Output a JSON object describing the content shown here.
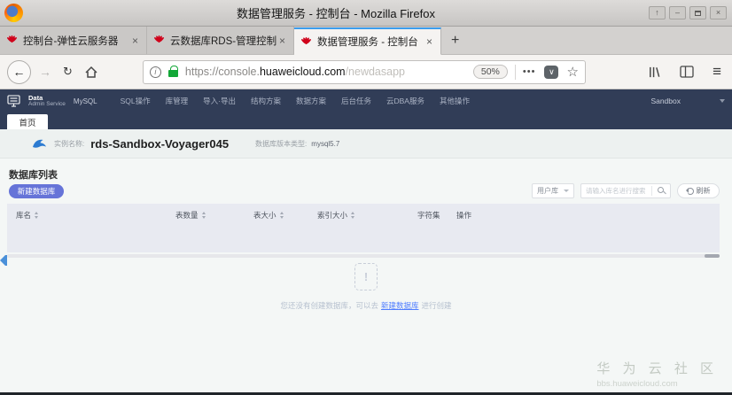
{
  "window": {
    "title": "数据管理服务 - 控制台 - Mozilla Firefox",
    "controls": {
      "shade": "↑",
      "minimize": "–",
      "close": "×"
    }
  },
  "browser": {
    "tabs": [
      {
        "label": "控制台-弹性云服务器",
        "close": "×"
      },
      {
        "label": "云数据库RDS-管理控制台",
        "close": "×"
      },
      {
        "label": "数据管理服务 - 控制台",
        "close": "×"
      }
    ],
    "new_tab": "+",
    "toolbar": {
      "back": "←",
      "forward": "→",
      "reload": "↻",
      "page_actions": "•••",
      "pocket": "∨",
      "bookmark_star": "☆",
      "menu": "≡"
    },
    "url": {
      "scheme_subdomain": "https://console.",
      "domain": "huaweicloud.com",
      "path": "/newdasapp",
      "zoom": "50%"
    }
  },
  "app": {
    "brand": {
      "line1": "Data",
      "line2": "Admin Service",
      "engine": "MySQL",
      "account": "Sandbox"
    },
    "nav": [
      "SQL操作",
      "库管理",
      "导入·导出",
      "结构方案",
      "数据方案",
      "后台任务",
      "云DBA服务",
      "其他操作"
    ],
    "page_tab": "首页",
    "instance": {
      "name_label": "实例名称:",
      "name": "rds-Sandbox-Voyager045",
      "version_label": "数据库版本类型:",
      "version": "mysql5.7"
    },
    "db_list": {
      "title": "数据库列表",
      "new_db_button": "新建数据库",
      "filter": "用户库",
      "search_placeholder": "请输入库名进行搜索",
      "refresh": "刷新",
      "headers": [
        "库名",
        "表数量",
        "表大小",
        "索引大小",
        "字符集",
        "操作"
      ],
      "empty": {
        "icon_glyph": "!",
        "before": "您还没有创建数据库，可以去",
        "link": "新建数据库",
        "after": "进行创建"
      }
    },
    "watermark": {
      "line1": "华 为 云 社 区",
      "line2": "bbs.huaweicloud.com"
    }
  },
  "colors": {
    "navbar": "#313d57",
    "accent_button": "#6674d8",
    "active_tab_stripe": "#3a9ced",
    "link": "#4f7dff",
    "lock_green": "#12a737"
  }
}
